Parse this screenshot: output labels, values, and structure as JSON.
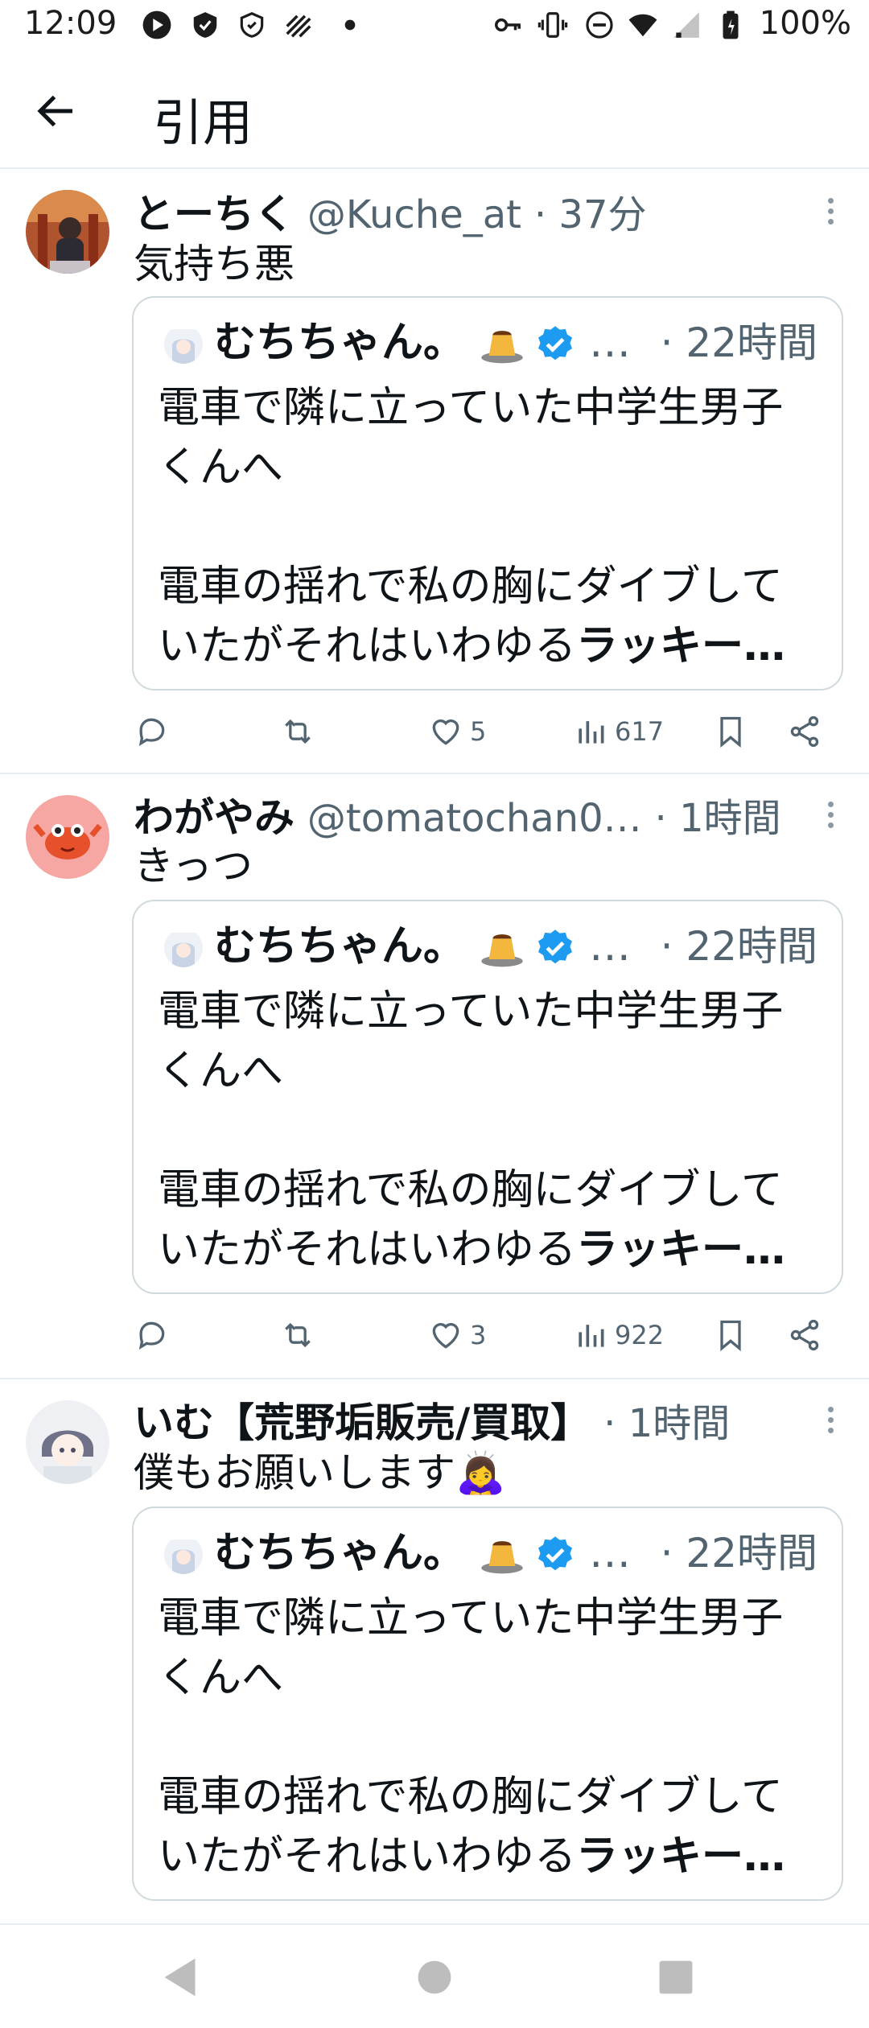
{
  "status_bar": {
    "time": "12:09",
    "battery": "100%",
    "icons_left": [
      "play-icon",
      "shield-icon",
      "shield-outline-icon",
      "stripes-icon",
      "dot-icon"
    ],
    "icons_right": [
      "key-icon",
      "vibrate-icon",
      "dnd-icon",
      "wifi-icon",
      "signal-icon",
      "battery-icon"
    ]
  },
  "header": {
    "title": "引用"
  },
  "quoted_tweet": {
    "name": "むちちゃん。",
    "ellipsis": "…",
    "time": "· 22時間",
    "line1": "電車で隣に立っていた中学生男子",
    "line2": "くんへ",
    "line3": "電車の揺れで私の胸にダイブして",
    "line4_prefix": "いたがそれはいわゆる",
    "line4_bold": "ラッキー…"
  },
  "tweets": [
    {
      "name": "とーちく",
      "handle": "@Kuche_at",
      "time": "· 37分",
      "text": "気持ち悪",
      "likes": "5",
      "views": "617"
    },
    {
      "name": "わがやみ",
      "handle": "@tomatochan0…",
      "time": "· 1時間",
      "text": "きっつ",
      "likes": "3",
      "views": "922"
    },
    {
      "name": "いむ【荒野垢販売/買取】",
      "handle": "",
      "time": "· 1時間",
      "text": "僕もお願いします🙇‍♀️"
    }
  ],
  "colors": {
    "accent": "#1d9bf0",
    "text": "#0f1419",
    "secondary": "#536471",
    "border": "#cfd9de"
  }
}
